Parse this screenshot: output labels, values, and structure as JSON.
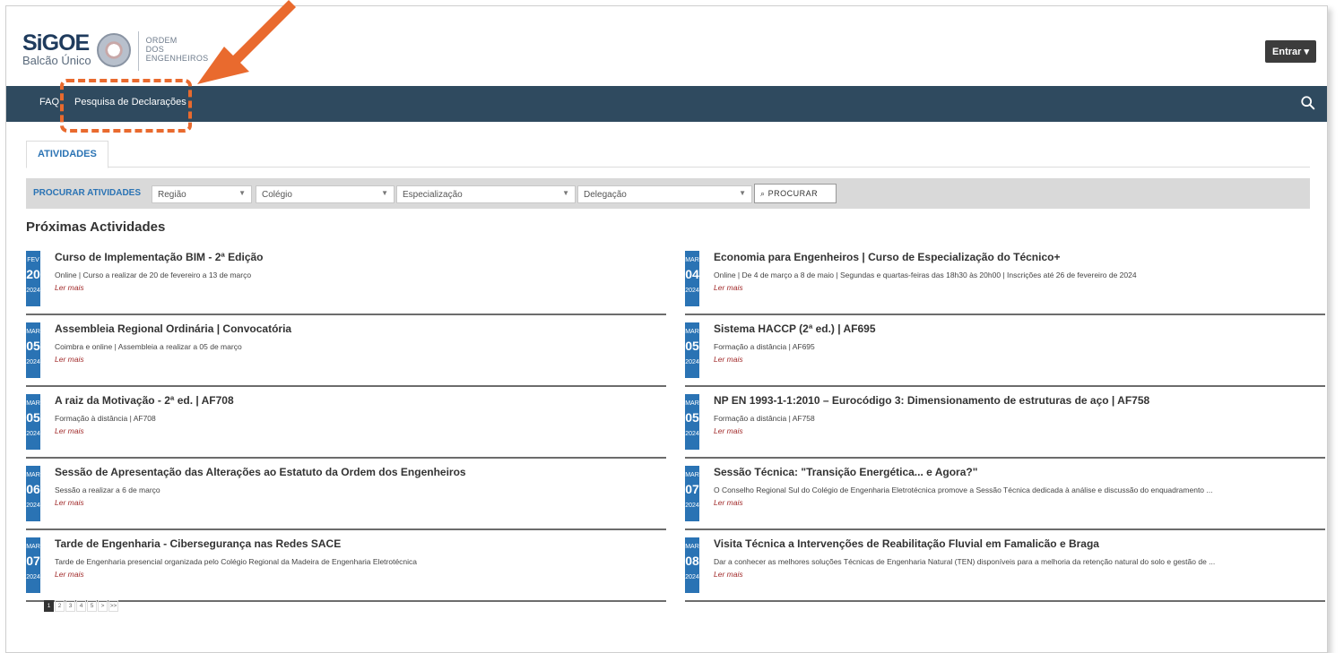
{
  "header": {
    "brand": "SiGOE",
    "subbrand": "Balcão Único",
    "org_lines": [
      "ORDEM",
      "DOS",
      "ENGENHEIROS"
    ],
    "login_label": "Entrar ▾"
  },
  "nav": {
    "items": [
      "FAQ",
      "Pesquisa de Declarações"
    ],
    "search_icon": "search-icon"
  },
  "tabs": [
    "ATIVIDADES"
  ],
  "filters": {
    "label": "PROCURAR ATIVIDADES",
    "selects": [
      "Região",
      "Colégio",
      "Especialização",
      "Delegação"
    ],
    "search_button": "PROCURAR"
  },
  "section_title": "Próximas Actividades",
  "events_left": [
    {
      "mon": "FEV",
      "day": "20",
      "year": "2024",
      "title": "Curso de Implementação BIM - 2ª Edição",
      "desc": "Online | Curso a realizar de 20 de fevereiro a 13 de março",
      "more": "Ler mais"
    },
    {
      "mon": "MAR",
      "day": "05",
      "year": "2024",
      "title": "Assembleia Regional Ordinária | Convocatória",
      "desc": "Coimbra e online | Assembleia a realizar a 05 de março",
      "more": "Ler mais"
    },
    {
      "mon": "MAR",
      "day": "05",
      "year": "2024",
      "title": "A raiz da Motivação - 2ª ed. | AF708",
      "desc": "Formação à distância | AF708",
      "more": "Ler mais"
    },
    {
      "mon": "MAR",
      "day": "06",
      "year": "2024",
      "title": "Sessão de Apresentação das Alterações ao Estatuto da Ordem dos Engenheiros",
      "desc": "Sessão a realizar a 6 de março",
      "more": "Ler mais"
    },
    {
      "mon": "MAR",
      "day": "07",
      "year": "2024",
      "title": "Tarde de Engenharia - Cibersegurança nas Redes SACE",
      "desc": "Tarde de Engenharia presencial organizada pelo Colégio Regional da Madeira de Engenharia Eletrotécnica",
      "more": "Ler mais"
    }
  ],
  "events_right": [
    {
      "mon": "MAR",
      "day": "04",
      "year": "2024",
      "title": "Economia para Engenheiros | Curso de Especialização do Técnico+",
      "desc": "Online | De 4 de março a 8 de maio | Segundas e quartas-feiras das 18h30 às 20h00 | Inscrições até 26 de fevereiro de 2024",
      "more": "Ler mais"
    },
    {
      "mon": "MAR",
      "day": "05",
      "year": "2024",
      "title": "Sistema HACCP (2ª ed.) | AF695",
      "desc": "Formação a distância | AF695",
      "more": "Ler mais"
    },
    {
      "mon": "MAR",
      "day": "05",
      "year": "2024",
      "title": "NP EN 1993-1-1:2010 – Eurocódigo 3: Dimensionamento de estruturas de aço | AF758",
      "desc": "Formação a distância | AF758",
      "more": "Ler mais"
    },
    {
      "mon": "MAR",
      "day": "07",
      "year": "2024",
      "title": "Sessão Técnica: \"Transição Energética... e Agora?\"",
      "desc": "O Conselho Regional Sul do Colégio de Engenharia Eletrotécnica promove a Sessão Técnica dedicada à análise e discussão do enquadramento ...",
      "more": "Ler mais"
    },
    {
      "mon": "MAR",
      "day": "08",
      "year": "2024",
      "title": "Visita Técnica a Intervenções de Reabilitação Fluvial em Famalicão e Braga",
      "desc": "Dar a conhecer as melhores soluções Técnicas de Engenharia Natural (TEN) disponíveis para a melhoria da retenção natural do solo e gestão de ...",
      "more": "Ler mais"
    }
  ],
  "pagination": [
    "1",
    "2",
    "3",
    "4",
    "5",
    ">",
    ">>"
  ],
  "colors": {
    "nav_bg": "#2f4a5f",
    "accent": "#2a73b4",
    "annotation": "#e96a2e"
  }
}
